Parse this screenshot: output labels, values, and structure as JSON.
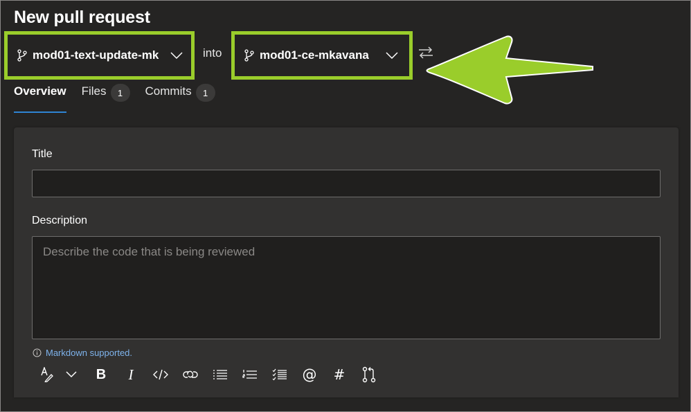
{
  "header": {
    "title": "New pull request",
    "source_branch": "mod01-text-update-mk",
    "into_label": "into",
    "target_branch": "mod01-ce-mkavana"
  },
  "annotation": {
    "highlight_color": "#9ACD2B",
    "arrow_color": "#9ACD2B"
  },
  "tabs": [
    {
      "label": "Overview",
      "active": true
    },
    {
      "label": "Files",
      "count": "1"
    },
    {
      "label": "Commits",
      "count": "1"
    }
  ],
  "form": {
    "title_label": "Title",
    "title_value": "",
    "description_label": "Description",
    "description_placeholder": "Describe the code that is being reviewed",
    "markdown_note": "Markdown supported."
  },
  "toolbar": {
    "items": [
      {
        "icon": "text-format-icon"
      },
      {
        "icon": "chevron-down-icon"
      },
      {
        "icon": "bold-icon",
        "glyph": "B"
      },
      {
        "icon": "italic-icon",
        "glyph": "I"
      },
      {
        "icon": "code-icon"
      },
      {
        "icon": "link-icon"
      },
      {
        "icon": "bulleted-list-icon"
      },
      {
        "icon": "numbered-list-icon"
      },
      {
        "icon": "task-list-icon"
      },
      {
        "icon": "mention-icon",
        "glyph": "@"
      },
      {
        "icon": "work-item-icon",
        "glyph": "#"
      },
      {
        "icon": "pull-request-icon"
      }
    ]
  },
  "colors": {
    "background": "#252423",
    "card": "#323130",
    "input": "#201f1e",
    "accent": "#2f84d4",
    "link": "#7eb3ec"
  }
}
